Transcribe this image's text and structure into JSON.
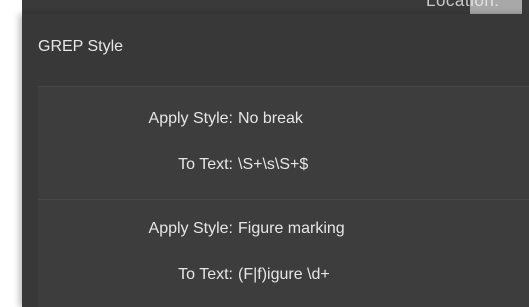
{
  "header": {
    "partial_label": "Location:"
  },
  "panel": {
    "title": "GREP Style",
    "rules": [
      {
        "apply_style_label": "Apply Style:",
        "apply_style_value": "No break",
        "to_text_label": "To Text:",
        "to_text_value": "\\S+\\s\\S+$"
      },
      {
        "apply_style_label": "Apply Style:",
        "apply_style_value": "Figure marking",
        "to_text_label": "To Text:",
        "to_text_value": "(F|f)igure \\d+"
      }
    ]
  },
  "colors": {
    "panel_bg": "#383838",
    "group_bg": "#3d3d3d",
    "text": "#e6e6e6"
  }
}
